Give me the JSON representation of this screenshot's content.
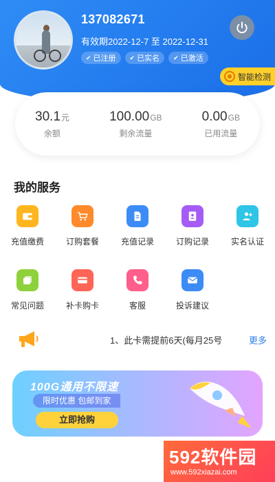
{
  "profile": {
    "phone": "137082671",
    "validity": "有效期2022-12-7 至 2022-12-31",
    "badges": [
      "已注册",
      "已实名",
      "已激活"
    ]
  },
  "detect_button": "智能检测",
  "stats": [
    {
      "value": "30.1",
      "unit": "元",
      "label": "余额"
    },
    {
      "value": "100.00",
      "unit": "GB",
      "label": "剩余流量"
    },
    {
      "value": "0.00",
      "unit": "GB",
      "label": "已用流量"
    }
  ],
  "services_title": "我的服务",
  "services": [
    {
      "label": "充值缴费",
      "icon": "wallet-icon",
      "color": "#ffb51f"
    },
    {
      "label": "订购套餐",
      "icon": "cart-icon",
      "color": "#ff8a2b"
    },
    {
      "label": "充值记录",
      "icon": "document-icon",
      "color": "#3d8cf5"
    },
    {
      "label": "订购记录",
      "icon": "contacts-book-icon",
      "color": "#a45cf5"
    },
    {
      "label": "实名认证",
      "icon": "add-user-icon",
      "color": "#2fc5e6"
    },
    {
      "label": "常见问题",
      "icon": "stack-icon",
      "color": "#8ed13a"
    },
    {
      "label": "补卡购卡",
      "icon": "card-icon",
      "color": "#ff6557"
    },
    {
      "label": "客服",
      "icon": "phone-icon",
      "color": "#ff5f8a"
    },
    {
      "label": "投诉建议",
      "icon": "mail-icon",
      "color": "#3d8cf5"
    }
  ],
  "notice": {
    "text": "1、此卡需提前6天(每月25号",
    "more": "更多"
  },
  "banner": {
    "title": "100G通用不限速",
    "subtitle": "限时优惠 包邮到家",
    "button": "立即抢购"
  },
  "watermark": {
    "brand": "592软件园",
    "url": "www.592xiazai.com"
  },
  "colors": {
    "header_blue": "#2f8cf5",
    "accent_yellow": "#ffd02a",
    "link_blue": "#2f7fe8"
  }
}
